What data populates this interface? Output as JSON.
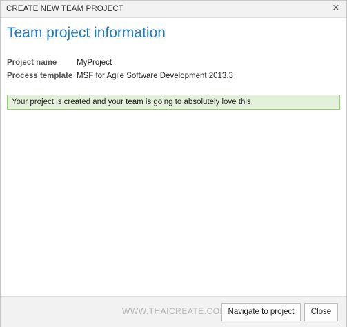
{
  "dialog": {
    "title": "CREATE NEW TEAM PROJECT",
    "close_glyph": "×"
  },
  "main": {
    "heading": "Team project information",
    "fields": [
      {
        "label": "Project name",
        "value": "MyProject"
      },
      {
        "label": "Process template",
        "value": "MSF for Agile Software Development 2013.3"
      }
    ],
    "success_message": "Your project is created and your team is going to absolutely love this."
  },
  "footer": {
    "watermark": "WWW.THAICREATE.COM",
    "navigate_label": "Navigate to project",
    "close_label": "Close"
  },
  "colors": {
    "heading": "#1d7cc4",
    "banner_bg": "#e3f1da",
    "banner_border": "#9bc988"
  },
  "icons": {
    "close": "close-icon"
  }
}
